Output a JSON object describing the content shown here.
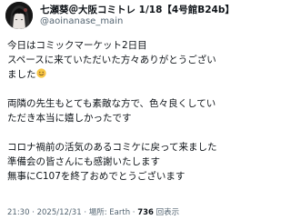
{
  "author": {
    "display_name": "七瀬葵＠大阪コミトレ 1/18【4号館B24b】",
    "handle": "@aoinanase_main"
  },
  "tweet": {
    "line1": "今日はコミックマーケット2日目",
    "line2": "スペースに来ていただいた方々ありがとうござい",
    "line3": "ました",
    "line3_emoji": "smiling-face-emoji",
    "line4": "両隣の先生もとても素敵な方で、色々良くしてい",
    "line5": "ただき本当に嬉しかったです",
    "line6": "コロナ禍前の活気のあるコミケに戻って来ました",
    "line7": "準備会の皆さんにも感謝いたします",
    "line8": "無事にC107を終了おめでとうございます"
  },
  "meta": {
    "time": "21:30",
    "date": "2025/12/31",
    "device": "Earth",
    "views_count": "736",
    "views_label": "回表示"
  },
  "colors": {
    "text": "#0f1419",
    "secondary": "#536471",
    "emoji": "#f7c744"
  }
}
